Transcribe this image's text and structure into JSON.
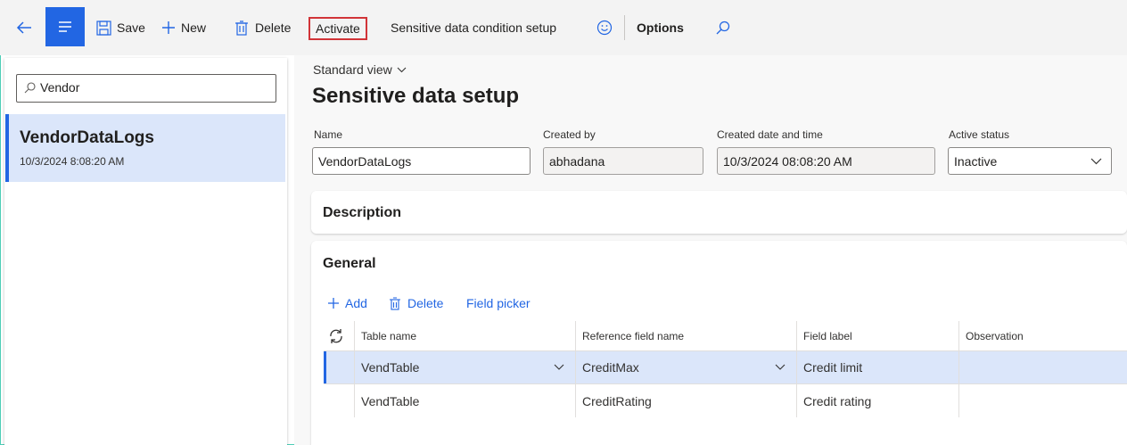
{
  "toolbar": {
    "save_label": "Save",
    "new_label": "New",
    "delete_label": "Delete",
    "activate_label": "Activate",
    "condition_setup_label": "Sensitive data condition setup",
    "options_label": "Options"
  },
  "left_pane": {
    "search_value": "Vendor",
    "items": [
      {
        "title": "VendorDataLogs",
        "subtitle": "10/3/2024 8:08:20 AM"
      }
    ]
  },
  "main": {
    "view_label": "Standard view",
    "page_title": "Sensitive data setup",
    "fields": {
      "name_label": "Name",
      "name_value": "VendorDataLogs",
      "created_by_label": "Created by",
      "created_by_value": "abhadana",
      "created_date_label": "Created date and time",
      "created_date_value": "10/3/2024 08:08:20 AM",
      "active_status_label": "Active status",
      "active_status_value": "Inactive"
    },
    "description_title": "Description",
    "general_title": "General",
    "grid_actions": {
      "add_label": "Add",
      "delete_label": "Delete",
      "field_picker_label": "Field picker"
    },
    "grid": {
      "headers": [
        "Table name",
        "Reference field name",
        "Field label",
        "Observation"
      ],
      "rows": [
        [
          "VendTable",
          "CreditMax",
          "Credit limit",
          ""
        ],
        [
          "VendTable",
          "CreditRating",
          "Credit rating",
          ""
        ]
      ]
    }
  },
  "colors": {
    "accent": "#2266e3",
    "selected_row": "#dbe6fa",
    "highlight_border": "#d13438",
    "frame": "#4ecdb6"
  }
}
